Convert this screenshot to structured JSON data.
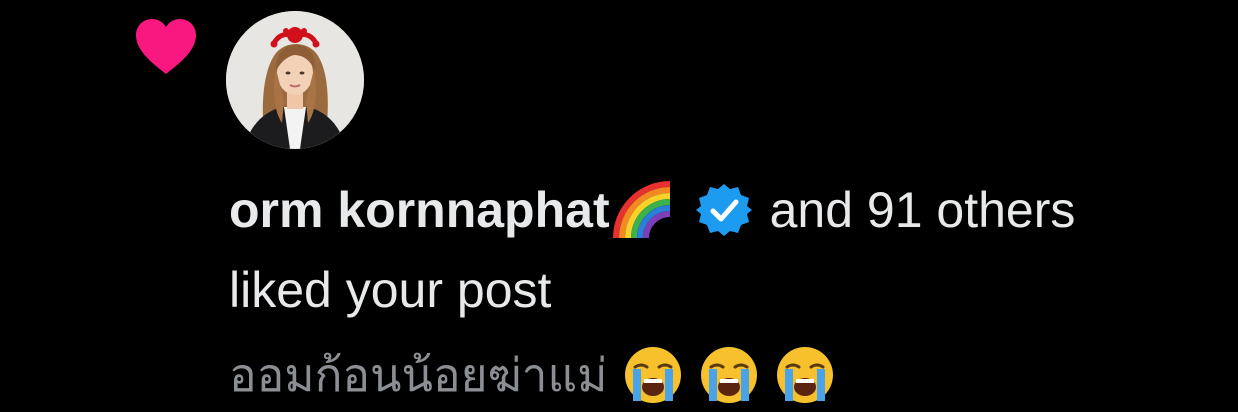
{
  "notification": {
    "icon": "heart-icon",
    "avatar_icon": "profile-avatar",
    "user_name": "orm kornnaphat",
    "name_emoji": "rainbow-emoji",
    "verified_icon": "verified-badge-icon",
    "others_text": "and 91 others",
    "action_text": "liked your post",
    "post_text": "ออมก้อนน้อยฆ่าแม่",
    "post_emojis": [
      "loudly-crying-face-emoji",
      "loudly-crying-face-emoji",
      "loudly-crying-face-emoji"
    ]
  },
  "colors": {
    "background": "#000000",
    "heart": "#f91880",
    "primary_text": "#e7e9ea",
    "secondary_text": "#8b8f94",
    "verified": "#1d9bf0"
  }
}
